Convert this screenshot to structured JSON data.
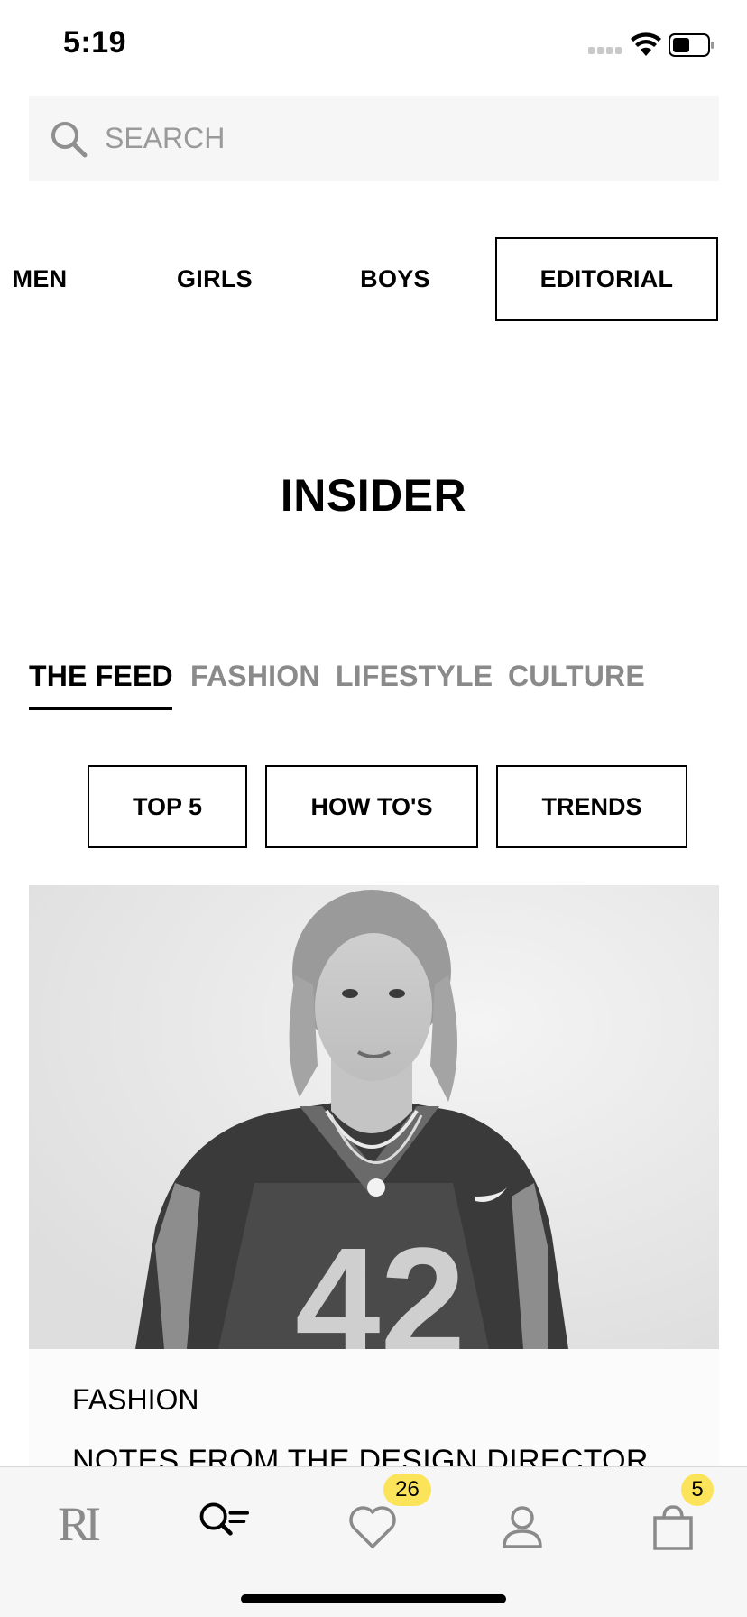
{
  "status_bar": {
    "time": "5:19"
  },
  "search": {
    "placeholder": "SEARCH"
  },
  "categories": [
    {
      "label": "MEN"
    },
    {
      "label": "GIRLS"
    },
    {
      "label": "BOYS"
    },
    {
      "label": "EDITORIAL",
      "active": true
    }
  ],
  "page_title": "INSIDER",
  "feed_tabs": [
    {
      "label": "THE FEED",
      "active": true
    },
    {
      "label": "FASHION"
    },
    {
      "label": "LIFESTYLE"
    },
    {
      "label": "CULTURE"
    }
  ],
  "filters": [
    {
      "label": "TOP 5"
    },
    {
      "label": "HOW TO'S"
    },
    {
      "label": "TRENDS"
    }
  ],
  "article": {
    "category": "FASHION",
    "title": "NOTES FROM THE DESIGN DIRECTOR"
  },
  "tab_bar": {
    "logo": "RI",
    "items": [
      {
        "icon": "logo-icon"
      },
      {
        "icon": "search-list-icon"
      },
      {
        "icon": "heart-icon",
        "badge": "26"
      },
      {
        "icon": "user-icon"
      },
      {
        "icon": "bag-icon",
        "badge": "5"
      }
    ]
  },
  "colors": {
    "badge": "#fbe45a",
    "inactive_tab": "#8a8a8a",
    "search_bg": "#f6f6f6"
  }
}
